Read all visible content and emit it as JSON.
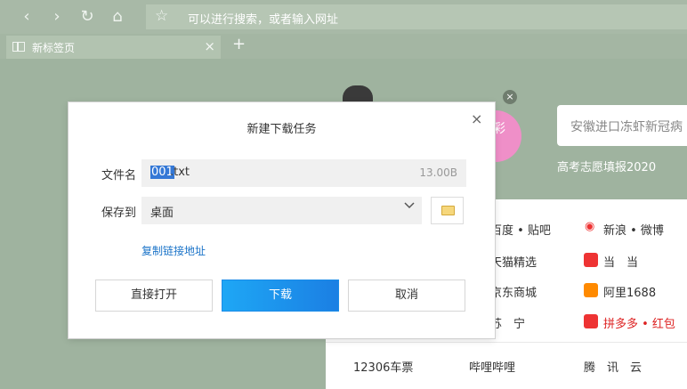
{
  "toolbar": {
    "back_icon": "chevron-left-icon",
    "forward_icon": "chevron-right-icon",
    "refresh_icon": "refresh-icon",
    "home_icon": "home-icon",
    "address_placeholder": "可以进行搜索，或者输入网址"
  },
  "tabs": [
    {
      "label": "新标签页",
      "close": "×"
    }
  ],
  "newtab": "+",
  "background": {
    "search_text": "安徽进口冻虾新冠病",
    "hot_link": "高考志愿填报2020",
    "pink_text": "彩",
    "close_mark": "×",
    "links": [
      [
        "百度 • 贴吧",
        "新浪 • 微博"
      ],
      [
        "天猫精选",
        "当　当"
      ],
      [
        "京东商城",
        "阿里1688"
      ],
      [
        "苏　宁",
        "拼多多 • 红包"
      ]
    ],
    "bottom_links": [
      "12306车票",
      "哔哩哔哩",
      "腾　讯　云"
    ]
  },
  "dialog": {
    "title": "新建下载任务",
    "close": "×",
    "filename_label": "文件名",
    "filename_selected": "001",
    "filename_rest": ".txt",
    "file_size": "13.00B",
    "saveto_label": "保存到",
    "saveto_value": "桌面",
    "copy_link": "复制链接地址",
    "open_button": "直接打开",
    "download_button": "下载",
    "cancel_button": "取消"
  },
  "colors": {
    "accent": "#1b7fe3",
    "link": "#1a73c8",
    "background": "#9fb39f"
  }
}
